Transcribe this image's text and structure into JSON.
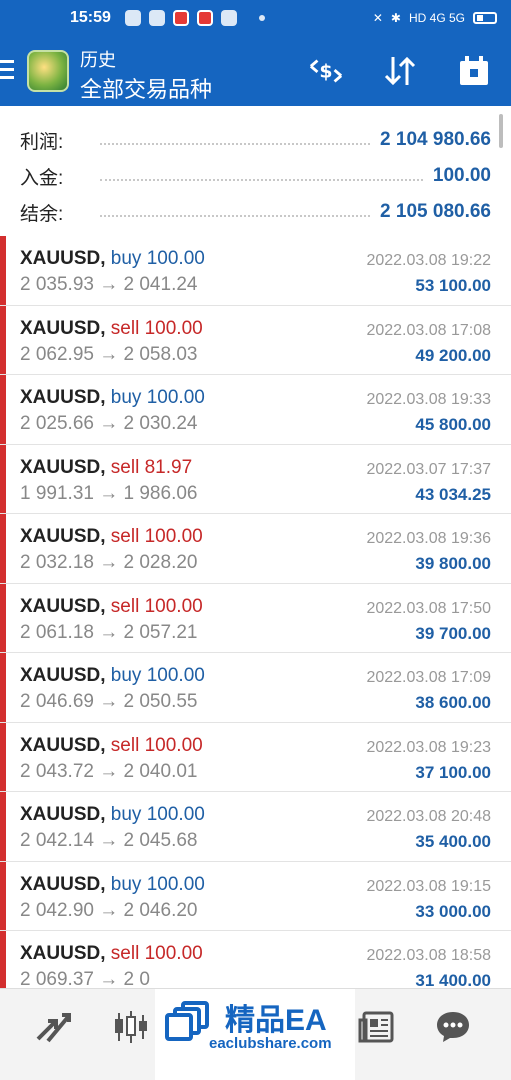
{
  "status_bar": {
    "time": "15:59",
    "network": "HD 4G 5G"
  },
  "app_bar": {
    "subtitle": "历史",
    "title": "全部交易品种",
    "icons": [
      "menu-icon",
      "currency-swap-icon",
      "sort-icon",
      "calendar-icon"
    ]
  },
  "summary": {
    "profit_label": "利润:",
    "profit_value": "2 104 980.66",
    "deposit_label": "入金:",
    "deposit_value": "100.00",
    "balance_label": "结余:",
    "balance_value": "2 105 080.66"
  },
  "trades": [
    {
      "symbol": "XAUUSD,",
      "side": "buy",
      "volume": "100.00",
      "prices": "2 035.93 → 2 041.24",
      "date": "2022.03.08 19:22",
      "profit": "53 100.00"
    },
    {
      "symbol": "XAUUSD,",
      "side": "sell",
      "volume": "100.00",
      "prices": "2 062.95 → 2 058.03",
      "date": "2022.03.08 17:08",
      "profit": "49 200.00"
    },
    {
      "symbol": "XAUUSD,",
      "side": "buy",
      "volume": "100.00",
      "prices": "2 025.66 → 2 030.24",
      "date": "2022.03.08 19:33",
      "profit": "45 800.00"
    },
    {
      "symbol": "XAUUSD,",
      "side": "sell",
      "volume": "81.97",
      "prices": "1 991.31 → 1 986.06",
      "date": "2022.03.07 17:37",
      "profit": "43 034.25"
    },
    {
      "symbol": "XAUUSD,",
      "side": "sell",
      "volume": "100.00",
      "prices": "2 032.18 → 2 028.20",
      "date": "2022.03.08 19:36",
      "profit": "39 800.00"
    },
    {
      "symbol": "XAUUSD,",
      "side": "sell",
      "volume": "100.00",
      "prices": "2 061.18 → 2 057.21",
      "date": "2022.03.08 17:50",
      "profit": "39 700.00"
    },
    {
      "symbol": "XAUUSD,",
      "side": "buy",
      "volume": "100.00",
      "prices": "2 046.69 → 2 050.55",
      "date": "2022.03.08 17:09",
      "profit": "38 600.00"
    },
    {
      "symbol": "XAUUSD,",
      "side": "sell",
      "volume": "100.00",
      "prices": "2 043.72 → 2 040.01",
      "date": "2022.03.08 19:23",
      "profit": "37 100.00"
    },
    {
      "symbol": "XAUUSD,",
      "side": "buy",
      "volume": "100.00",
      "prices": "2 042.14 → 2 045.68",
      "date": "2022.03.08 20:48",
      "profit": "35 400.00"
    },
    {
      "symbol": "XAUUSD,",
      "side": "buy",
      "volume": "100.00",
      "prices": "2 042.90 → 2 046.20",
      "date": "2022.03.08 19:15",
      "profit": "33 000.00"
    },
    {
      "symbol": "XAUUSD,",
      "side": "sell",
      "volume": "100.00",
      "prices": "2 069.37 → 2 0",
      "date": "2022.03.08 18:58",
      "profit": "31 400.00"
    }
  ],
  "bottom_nav": {
    "icons": [
      "trade-arrows-icon",
      "candlestick-chart-icon",
      "news-icon",
      "chat-icon"
    ],
    "watermark_title": "精品EA",
    "watermark_url": "eaclubshare.com"
  },
  "colors": {
    "header": "#1565c0",
    "profit_blue": "#1f5fa5",
    "sell_red": "#c62828",
    "loss_bar": "#d32f2f"
  }
}
